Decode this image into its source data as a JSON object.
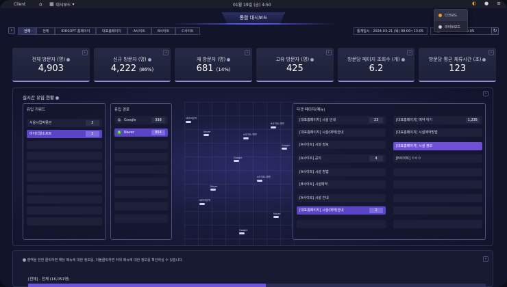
{
  "os": {
    "client": "Client",
    "dashboard_menu": "대시보드",
    "date": "01월 19일 (금) 4:50"
  },
  "theme_menu": {
    "items": [
      {
        "label": "다크모드",
        "color": "#f0a020"
      },
      {
        "label": "라이트모드",
        "color": "#c8cbe0"
      }
    ]
  },
  "header": {
    "title": "통합 대시보드"
  },
  "nav": {
    "tabs": [
      "전체",
      "전체",
      "IDRSOFT 홈페이지",
      "대표홈페이지",
      "A사이트",
      "B사이트",
      "C사이트"
    ],
    "stat1": "통계일시 : 2024-03-21 (목) 00:00~13:05",
    "stat2": "최근 : 2024-03-21 13:05"
  },
  "kpis": [
    {
      "label": "전체 방문자 (명)",
      "value": "4,903",
      "pct": ""
    },
    {
      "label": "신규 방문자 (명)",
      "value": "4,222",
      "pct": "(86%)"
    },
    {
      "label": "재 방문자 (명)",
      "value": "681",
      "pct": "(14%)"
    },
    {
      "label": "고유 방문자 (명)",
      "value": "425",
      "pct": ""
    },
    {
      "label": "방문당 페이지 조회수 (개)",
      "value": "6.2",
      "pct": ""
    },
    {
      "label": "방문당 평균 체류시간 (초)",
      "value": "123",
      "pct": ""
    }
  ],
  "realtime": {
    "title": "실시간 유입 현황",
    "keywords": {
      "header": "유입 키워드",
      "rows": [
        {
          "label": "서울시립박물관",
          "count": "2"
        },
        {
          "label": "아이디알소프트",
          "count": "2"
        }
      ]
    },
    "sources": {
      "header": "유입 경로",
      "rows": [
        {
          "label": "Google",
          "count": "338"
        },
        {
          "label": "Naver",
          "count": "854"
        }
      ]
    },
    "targets": {
      "header": "타겟 페이지(메뉴)",
      "left": [
        {
          "label": "[대표홈페이지] 시설 안내",
          "count": "23"
        },
        {
          "label": "[대표홈페이지] 시설(예약)안내",
          "count": ""
        },
        {
          "label": "[A사이트] 시설 정보",
          "count": ""
        },
        {
          "label": "[A사이트] 공지",
          "count": "4"
        },
        {
          "label": "[A사이트] 시설 방법",
          "count": ""
        },
        {
          "label": "[B사이트] 시설예약",
          "count": ""
        },
        {
          "label": "[A사이트] 시설 안내",
          "count": ""
        },
        {
          "label": "[대표홈페이지] 시설(예약)안내",
          "count": "2"
        }
      ],
      "right": [
        {
          "label": "[대표홈페이지] 예약 하기",
          "count": "1,235"
        },
        {
          "label": "[대표홈페이지] 시설예약방법",
          "count": ""
        },
        {
          "label": "[대표홈페이지] 시설 정보",
          "count": ""
        },
        {
          "label": "[B사이트] ㅇㅇㅇ",
          "count": ""
        }
      ]
    },
    "flows": [
      "네이버검색",
      "Naver",
      "Google",
      "A사이트-예약",
      "B사이트-예약",
      "네이버검색",
      "Google",
      "A사이트-예약",
      "Naver",
      "Naver",
      "Google"
    ]
  },
  "bottom": {
    "note": "영역을 한번 클릭하면 해당 메뉴에 대한 정보를, 더블클릭하면 하위 메뉴에 대한 정보를 확인하실 수 있습니다.",
    "total_label": "[전체] - 전체 (16,051명)",
    "fill": 0.52
  }
}
